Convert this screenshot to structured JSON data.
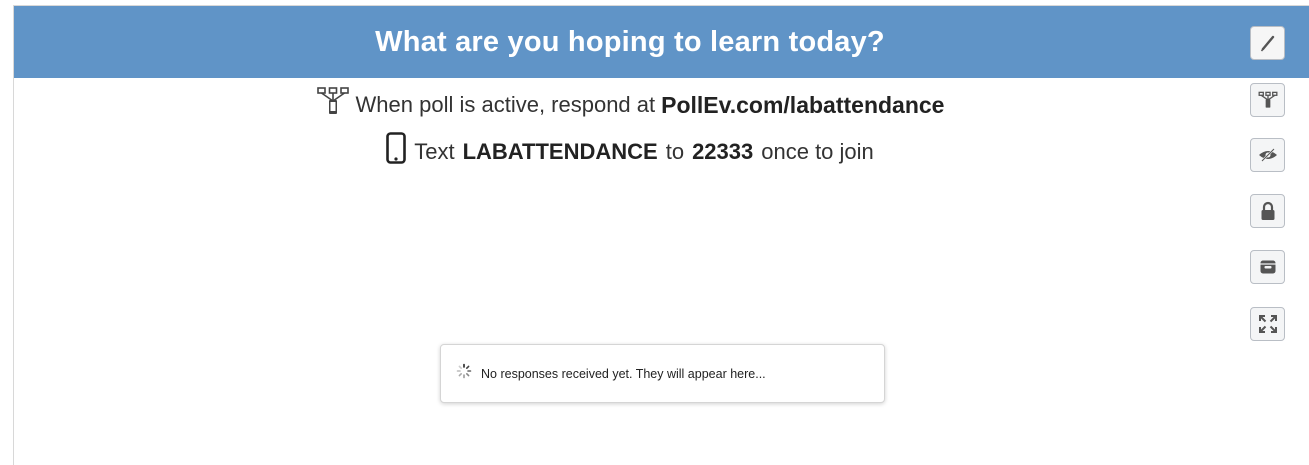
{
  "poll": {
    "title": "What are you hoping to learn today?"
  },
  "instructions": {
    "web_prefix": "When poll is active, respond at",
    "web_url": "PollEv.com/labattendance",
    "text_prefix": "Text",
    "text_keyword": "LABATTENDANCE",
    "text_to": "to",
    "text_number": "22333",
    "text_suffix": "once to join"
  },
  "responses": {
    "empty_message": "No responses received yet. They will appear here..."
  },
  "toolbar": {
    "icons": [
      "pen-icon",
      "activate-poll-icon",
      "hide-icon",
      "lock-icon",
      "archive-icon",
      "fullscreen-icon"
    ]
  },
  "colors": {
    "header_bg": "#6094c7",
    "header_text": "#ffffff"
  }
}
